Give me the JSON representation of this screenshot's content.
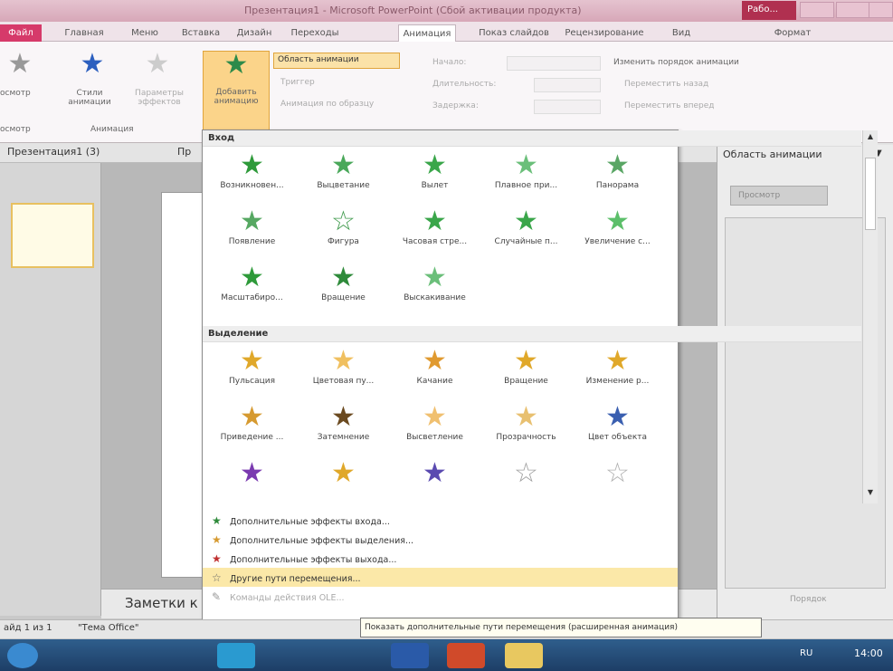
{
  "window": {
    "title": "Презентация1 - Microsoft PowerPoint (Сбой активации продукта)",
    "work_badge": "Рабо..."
  },
  "tabs": [
    {
      "label": "Файл"
    },
    {
      "label": "Главная"
    },
    {
      "label": "Меню"
    },
    {
      "label": "Вставка"
    },
    {
      "label": "Дизайн"
    },
    {
      "label": "Переходы"
    },
    {
      "label": "Анимация"
    },
    {
      "label": "Показ слайдов"
    },
    {
      "label": "Рецензирование"
    },
    {
      "label": "Вид"
    },
    {
      "label": "Формат"
    }
  ],
  "ribbon": {
    "preview": "осмотр",
    "preview_group": "осмотр",
    "styles_label": "Стили анимации",
    "params_label": "Параметры эффектов",
    "group_anim": "Анимация",
    "add_anim": "Добавить анимацию",
    "anim_pane": "Область анимации",
    "trigger": "Триггер",
    "by_sample": "Анимация по образцу",
    "start": "Начало:",
    "duration": "Длительность:",
    "delay": "Задержка:",
    "reorder": "Изменить порядок анимации",
    "move_back": "Переместить назад",
    "move_fwd": "Переместить вперед"
  },
  "docstrip": {
    "tab1": "Презентация1 (3)",
    "tab2": "Пр"
  },
  "anim_pane": {
    "title": "Область анимации",
    "play": "Просмотр",
    "order": "Порядок"
  },
  "gallery": {
    "entry_header": "Вход",
    "entry": [
      {
        "label": "Возникновен...",
        "icon": "star-green-icon",
        "color": "#2e9a3a"
      },
      {
        "label": "Выцветание",
        "icon": "star-green-icon",
        "color": "#4aa85a"
      },
      {
        "label": "Вылет",
        "icon": "star-green-icon",
        "color": "#3aa64a"
      },
      {
        "label": "Плавное при...",
        "icon": "star-green-icon",
        "color": "#6bbf7a"
      },
      {
        "label": "Панорама",
        "icon": "star-green-icon",
        "color": "#5aa665"
      },
      {
        "label": "Появление",
        "icon": "star-green-icon",
        "color": "#56a862"
      },
      {
        "label": "Фигура",
        "icon": "star-outline-icon",
        "color": "#3f9a4c"
      },
      {
        "label": "Часовая стре...",
        "icon": "star-green-icon",
        "color": "#3aa64a"
      },
      {
        "label": "Случайные п...",
        "icon": "star-green-icon",
        "color": "#3aa64a"
      },
      {
        "label": "Увеличение с...",
        "icon": "star-scatter-icon",
        "color": "#5cbf6a"
      },
      {
        "label": "Масштабиро...",
        "icon": "star-burst-icon",
        "color": "#2e9a3a"
      },
      {
        "label": "Вращение",
        "icon": "star-green-icon",
        "color": "#2e8a3a"
      },
      {
        "label": "Выскакивание",
        "icon": "star-bounce-icon",
        "color": "#6bbf7a"
      }
    ],
    "emphasis_header": "Выделение",
    "emphasis": [
      {
        "label": "Пульсация",
        "icon": "star-gold-icon",
        "color": "#e0a82a"
      },
      {
        "label": "Цветовая пу...",
        "icon": "star-gold-icon",
        "color": "#f0c060"
      },
      {
        "label": "Качание",
        "icon": "star-gold-icon",
        "color": "#e09a30"
      },
      {
        "label": "Вращение",
        "icon": "star-gold-icon",
        "color": "#e0a82a"
      },
      {
        "label": "Изменение р...",
        "icon": "star-gold-icon",
        "color": "#e0a82a"
      },
      {
        "label": "Приведение ...",
        "icon": "star-gold-icon",
        "color": "#d69a30"
      },
      {
        "label": "Затемнение",
        "icon": "star-dark-icon",
        "color": "#6b4a20"
      },
      {
        "label": "Высветление",
        "icon": "star-gold-icon",
        "color": "#f0c070"
      },
      {
        "label": "Прозрачность",
        "icon": "star-gold-icon",
        "color": "#e8c070"
      },
      {
        "label": "Цвет объекта",
        "icon": "star-blue-icon",
        "color": "#3a5fb0"
      },
      {
        "label": "",
        "icon": "star-purple-icon",
        "color": "#7a3ab0"
      },
      {
        "label": "",
        "icon": "star-gold-icon",
        "color": "#e0a82a"
      },
      {
        "label": "",
        "icon": "star-purple-icon",
        "color": "#5a4ab0"
      },
      {
        "label": "",
        "icon": "star-grey-icon",
        "color": "#a0a0a0"
      },
      {
        "label": "",
        "icon": "star-grey-icon",
        "color": "#b0b0b0"
      }
    ],
    "menu": [
      {
        "label": "Дополнительные эффекты входа...",
        "icon": "star-green-icon",
        "color": "#2e8a3a"
      },
      {
        "label": "Дополнительные эффекты выделения...",
        "icon": "star-gold-icon",
        "color": "#d69a30"
      },
      {
        "label": "Дополнительные эффекты выхода...",
        "icon": "star-red-icon",
        "color": "#c03030"
      },
      {
        "label": "Другие пути перемещения...",
        "icon": "star-outline-icon",
        "color": "#666666"
      },
      {
        "label": "Команды действия OLE...",
        "icon": "pencil-icon",
        "color": "#999999"
      }
    ]
  },
  "notes": {
    "label": "Заметки к"
  },
  "status": {
    "slide": "айд 1 из 1",
    "theme": "\"Тема Office\"",
    "lang": "RU",
    "time": "14:00"
  },
  "tooltip": "Показать дополнительные пути перемещения (расширенная анимация)"
}
